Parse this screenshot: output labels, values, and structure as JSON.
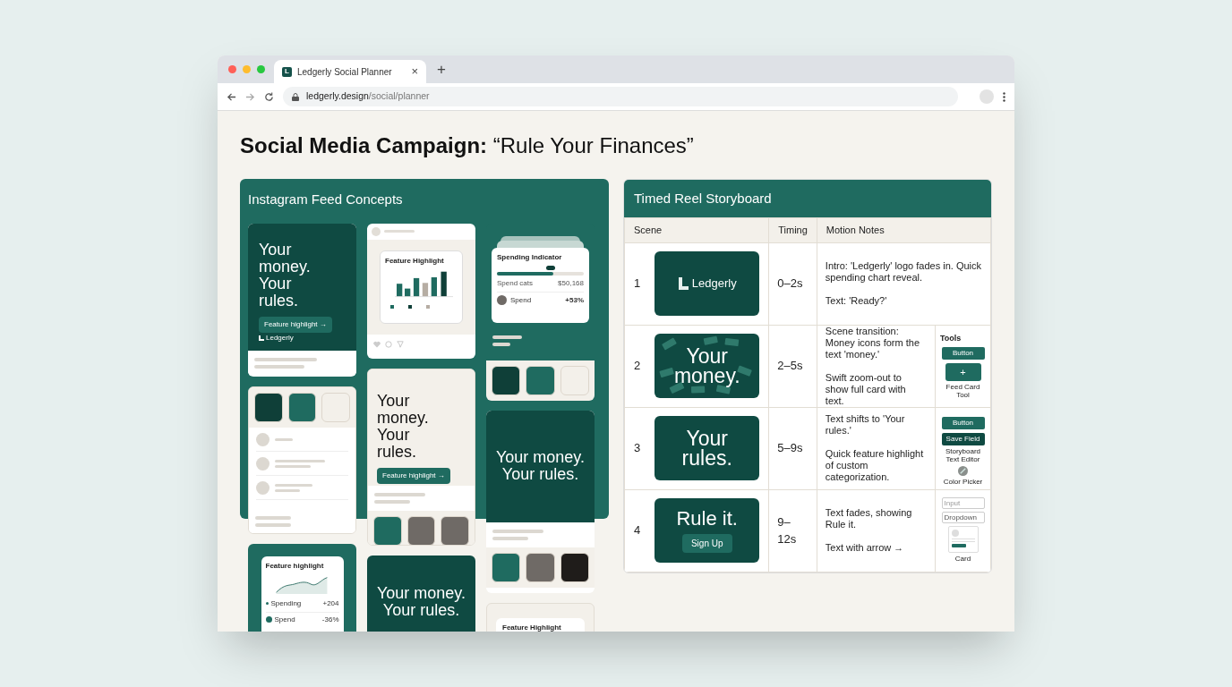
{
  "browser": {
    "tab": {
      "title": "Ledgerly Social Planner",
      "favicon": "L",
      "close": "×"
    },
    "new_tab": "+",
    "url_host": "ledgerly.design",
    "url_path": "/social/planner"
  },
  "title": "**Social Media Campaign:** “Rule Your Finances”",
  "feed": {
    "title": "Instagram Feed Concepts",
    "columns": [
      [
        {
          "kind": "hero",
          "headline": "Your money. Your rules.",
          "cta": "Feature highlight →",
          "logo": "Ledgerly"
        },
        {
          "kind": "swatch_list",
          "swatches": [
            {
              "color": "#0f3f38"
            },
            {
              "color": "#1f6b60"
            },
            {
              "color": "#f3f0ea"
            }
          ]
        },
        {
          "kind": "chart_card",
          "card_title": "Feature highlight",
          "rows": [
            {
              "label": "Spending",
              "value": "+204"
            },
            {
              "label": "Spend",
              "value": "-36%"
            }
          ]
        }
      ],
      [
        {
          "kind": "bar_post",
          "card_title": "Feature Highlight"
        },
        {
          "kind": "cream_hero",
          "headline": "Your money. Your rules.",
          "cta": "Feature highlight →",
          "swatches": [
            {
              "color": "#1f6b60"
            },
            {
              "color": "#6f6a66"
            },
            {
              "color": "#6f6a66"
            }
          ]
        },
        {
          "kind": "center_hero",
          "headline": "Your money. Your rules."
        }
      ],
      [
        {
          "kind": "indicator",
          "card_title": "Spending Indicator",
          "level": 0.65,
          "row_label": "Spend cats",
          "row_value": "$50,168",
          "spend_label": "Spend",
          "spend_value": "+53%",
          "swatches": [
            {
              "color": "#0f3f38"
            },
            {
              "color": "#1f6b60"
            },
            {
              "color": "#f3f0ea"
            }
          ]
        },
        {
          "kind": "center_hero",
          "headline": "Your money. Your rules.",
          "swatches": [
            {
              "color": "#1f6b60"
            },
            {
              "color": "#6f6a66"
            },
            {
              "color": "#1f1c1a"
            }
          ]
        },
        {
          "kind": "stub",
          "card_title": "Feature Highlight"
        }
      ]
    ]
  },
  "storyboard": {
    "title": "Timed Reel Storyboard",
    "columns": [
      "Scene",
      "Timing",
      "Motion Notes"
    ],
    "tools_title": "Tools",
    "rows": [
      {
        "scene": "1",
        "thumb": {
          "kind": "logo",
          "text": "Ledgerly"
        },
        "timing": "0–2s",
        "notes": [
          "Intro: 'Ledgerly' logo fades in. Quick spending chart reveal.",
          "Text: 'Ready?'"
        ]
      },
      {
        "scene": "2",
        "thumb": {
          "kind": "money",
          "text": "Your money."
        },
        "timing": "2–5s",
        "notes": [
          "Scene transition: Money icons form the text 'money.'",
          "Swift zoom-out to show full card with text."
        ],
        "tools": [
          {
            "kind": "button",
            "text": "Button"
          },
          {
            "kind": "plus",
            "text": "+"
          },
          {
            "kind": "label",
            "text": "Feed Card Tool"
          }
        ]
      },
      {
        "scene": "3",
        "thumb": {
          "kind": "text",
          "text": "Your rules."
        },
        "timing": "5–9s",
        "notes": [
          "Text shifts to 'Your rules.'",
          "Quick feature highlight of custom categorization."
        ],
        "tools": [
          {
            "kind": "button",
            "text": "Button"
          },
          {
            "kind": "dark_button",
            "text": "Save Field"
          },
          {
            "kind": "label",
            "text": "Storyboard Text Editor"
          },
          {
            "kind": "picker"
          },
          {
            "kind": "label",
            "text": "Color Picker"
          }
        ]
      },
      {
        "scene": "4",
        "thumb": {
          "kind": "cta",
          "text": "Rule it.",
          "button": "Sign Up"
        },
        "timing": "9–12s",
        "notes": [
          "Text fades, showing Rule it.",
          "Text with arrow →"
        ],
        "tools": [
          {
            "kind": "input",
            "text": "Input"
          },
          {
            "kind": "dropdown",
            "text": "Dropdown"
          },
          {
            "kind": "card"
          },
          {
            "kind": "label",
            "text": "Card"
          }
        ]
      }
    ]
  }
}
